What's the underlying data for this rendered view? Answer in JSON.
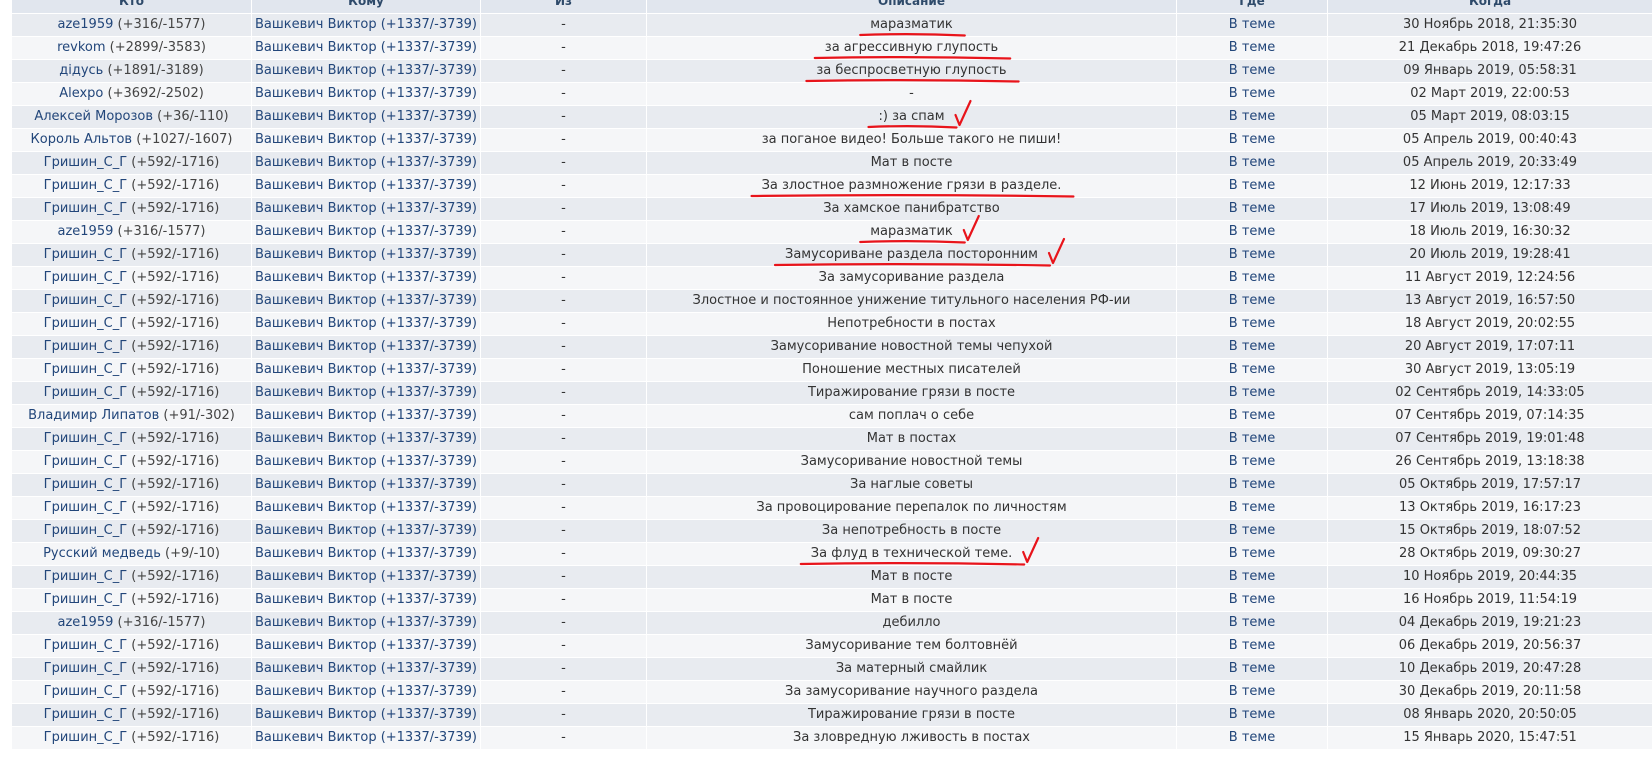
{
  "table": {
    "headers": [
      "Кто",
      "Кому",
      "Из",
      "Описание",
      "Где",
      "Когда"
    ],
    "rows": [
      {
        "who_name": "aze1959",
        "who_rep": "(+316/-1577)",
        "to": "Вашкевич Виктор (+1337/-3739)",
        "from": "-",
        "desc": "маразматик",
        "where": "В теме",
        "when": "30 Ноябрь 2018, 21:35:30"
      },
      {
        "who_name": "revkom",
        "who_rep": "(+2899/-3583)",
        "to": "Вашкевич Виктор (+1337/-3739)",
        "from": "-",
        "desc": "за агрессивную глупость",
        "where": "В теме",
        "when": "21 Декабрь 2018, 19:47:26"
      },
      {
        "who_name": "дідусь",
        "who_rep": "(+1891/-3189)",
        "to": "Вашкевич Виктор (+1337/-3739)",
        "from": "-",
        "desc": "за беспросветную глупость",
        "where": "В теме",
        "when": "09 Январь 2019, 05:58:31"
      },
      {
        "who_name": "Alexpo",
        "who_rep": "(+3692/-2502)",
        "to": "Вашкевич Виктор (+1337/-3739)",
        "from": "-",
        "desc": "-",
        "where": "В теме",
        "when": "02 Март 2019, 22:00:53"
      },
      {
        "who_name": "Алексей Морозов",
        "who_rep": "(+36/-110)",
        "to": "Вашкевич Виктор (+1337/-3739)",
        "from": "-",
        "desc": ":) за спам",
        "where": "В теме",
        "when": "05 Март 2019, 08:03:15"
      },
      {
        "who_name": "Король Альтов",
        "who_rep": "(+1027/-1607)",
        "to": "Вашкевич Виктор (+1337/-3739)",
        "from": "-",
        "desc": "за поганое видео! Больше такого не пиши!",
        "where": "В теме",
        "when": "05 Апрель 2019, 00:40:43"
      },
      {
        "who_name": "Гришин_С_Г",
        "who_rep": "(+592/-1716)",
        "to": "Вашкевич Виктор (+1337/-3739)",
        "from": "-",
        "desc": "Мат в посте",
        "where": "В теме",
        "when": "05 Апрель 2019, 20:33:49"
      },
      {
        "who_name": "Гришин_С_Г",
        "who_rep": "(+592/-1716)",
        "to": "Вашкевич Виктор (+1337/-3739)",
        "from": "-",
        "desc": "За злостное размножение грязи в разделе.",
        "where": "В теме",
        "when": "12 Июнь 2019, 12:17:33"
      },
      {
        "who_name": "Гришин_С_Г",
        "who_rep": "(+592/-1716)",
        "to": "Вашкевич Виктор (+1337/-3739)",
        "from": "-",
        "desc": "За хамское панибратство",
        "where": "В теме",
        "when": "17 Июль 2019, 13:08:49"
      },
      {
        "who_name": "aze1959",
        "who_rep": "(+316/-1577)",
        "to": "Вашкевич Виктор (+1337/-3739)",
        "from": "-",
        "desc": "маразматик",
        "where": "В теме",
        "when": "18 Июль 2019, 16:30:32"
      },
      {
        "who_name": "Гришин_С_Г",
        "who_rep": "(+592/-1716)",
        "to": "Вашкевич Виктор (+1337/-3739)",
        "from": "-",
        "desc": "Замусориване раздела посторонним",
        "where": "В теме",
        "when": "20 Июль 2019, 19:28:41"
      },
      {
        "who_name": "Гришин_С_Г",
        "who_rep": "(+592/-1716)",
        "to": "Вашкевич Виктор (+1337/-3739)",
        "from": "-",
        "desc": "За замусоривание раздела",
        "where": "В теме",
        "when": "11 Август 2019, 12:24:56"
      },
      {
        "who_name": "Гришин_С_Г",
        "who_rep": "(+592/-1716)",
        "to": "Вашкевич Виктор (+1337/-3739)",
        "from": "-",
        "desc": "Злостное и постоянное унижение титульного населения РФ-ии",
        "where": "В теме",
        "when": "13 Август 2019, 16:57:50"
      },
      {
        "who_name": "Гришин_С_Г",
        "who_rep": "(+592/-1716)",
        "to": "Вашкевич Виктор (+1337/-3739)",
        "from": "-",
        "desc": "Непотребности в постах",
        "where": "В теме",
        "when": "18 Август 2019, 20:02:55"
      },
      {
        "who_name": "Гришин_С_Г",
        "who_rep": "(+592/-1716)",
        "to": "Вашкевич Виктор (+1337/-3739)",
        "from": "-",
        "desc": "Замусоривание новостной темы чепухой",
        "where": "В теме",
        "when": "20 Август 2019, 17:07:11"
      },
      {
        "who_name": "Гришин_С_Г",
        "who_rep": "(+592/-1716)",
        "to": "Вашкевич Виктор (+1337/-3739)",
        "from": "-",
        "desc": "Поношение местных писателей",
        "where": "В теме",
        "when": "30 Август 2019, 13:05:19"
      },
      {
        "who_name": "Гришин_С_Г",
        "who_rep": "(+592/-1716)",
        "to": "Вашкевич Виктор (+1337/-3739)",
        "from": "-",
        "desc": "Тиражирование грязи в посте",
        "where": "В теме",
        "when": "02 Сентябрь 2019, 14:33:05"
      },
      {
        "who_name": "Владимир Липатов",
        "who_rep": "(+91/-302)",
        "to": "Вашкевич Виктор (+1337/-3739)",
        "from": "-",
        "desc": "сам поплач о себе",
        "where": "В теме",
        "when": "07 Сентябрь 2019, 07:14:35"
      },
      {
        "who_name": "Гришин_С_Г",
        "who_rep": "(+592/-1716)",
        "to": "Вашкевич Виктор (+1337/-3739)",
        "from": "-",
        "desc": "Мат в постах",
        "where": "В теме",
        "when": "07 Сентябрь 2019, 19:01:48"
      },
      {
        "who_name": "Гришин_С_Г",
        "who_rep": "(+592/-1716)",
        "to": "Вашкевич Виктор (+1337/-3739)",
        "from": "-",
        "desc": "Замусоривание новостной темы",
        "where": "В теме",
        "when": "26 Сентябрь 2019, 13:18:38"
      },
      {
        "who_name": "Гришин_С_Г",
        "who_rep": "(+592/-1716)",
        "to": "Вашкевич Виктор (+1337/-3739)",
        "from": "-",
        "desc": "За наглые советы",
        "where": "В теме",
        "when": "05 Октябрь 2019, 17:57:17"
      },
      {
        "who_name": "Гришин_С_Г",
        "who_rep": "(+592/-1716)",
        "to": "Вашкевич Виктор (+1337/-3739)",
        "from": "-",
        "desc": "За провоцирование перепалок по личностям",
        "where": "В теме",
        "when": "13 Октябрь 2019, 16:17:23"
      },
      {
        "who_name": "Гришин_С_Г",
        "who_rep": "(+592/-1716)",
        "to": "Вашкевич Виктор (+1337/-3739)",
        "from": "-",
        "desc": "За непотребность в посте",
        "where": "В теме",
        "when": "15 Октябрь 2019, 18:07:52"
      },
      {
        "who_name": "Русский медведь",
        "who_rep": "(+9/-10)",
        "to": "Вашкевич Виктор (+1337/-3739)",
        "from": "-",
        "desc": "За флуд в технической теме.",
        "where": "В теме",
        "when": "28 Октябрь 2019, 09:30:27"
      },
      {
        "who_name": "Гришин_С_Г",
        "who_rep": "(+592/-1716)",
        "to": "Вашкевич Виктор (+1337/-3739)",
        "from": "-",
        "desc": "Мат в посте",
        "where": "В теме",
        "when": "10 Ноябрь 2019, 20:44:35"
      },
      {
        "who_name": "Гришин_С_Г",
        "who_rep": "(+592/-1716)",
        "to": "Вашкевич Виктор (+1337/-3739)",
        "from": "-",
        "desc": "Мат в посте",
        "where": "В теме",
        "when": "16 Ноябрь 2019, 11:54:19"
      },
      {
        "who_name": "aze1959",
        "who_rep": "(+316/-1577)",
        "to": "Вашкевич Виктор (+1337/-3739)",
        "from": "-",
        "desc": "дебилло",
        "where": "В теме",
        "when": "04 Декабрь 2019, 19:21:23"
      },
      {
        "who_name": "Гришин_С_Г",
        "who_rep": "(+592/-1716)",
        "to": "Вашкевич Виктор (+1337/-3739)",
        "from": "-",
        "desc": "Замусоривание тем болтовнёй",
        "where": "В теме",
        "when": "06 Декабрь 2019, 20:56:37"
      },
      {
        "who_name": "Гришин_С_Г",
        "who_rep": "(+592/-1716)",
        "to": "Вашкевич Виктор (+1337/-3739)",
        "from": "-",
        "desc": "За матерный смайлик",
        "where": "В теме",
        "when": "10 Декабрь 2019, 20:47:28"
      },
      {
        "who_name": "Гришин_С_Г",
        "who_rep": "(+592/-1716)",
        "to": "Вашкевич Виктор (+1337/-3739)",
        "from": "-",
        "desc": "За замусоривание научного раздела",
        "where": "В теме",
        "when": "30 Декабрь 2019, 20:11:58"
      },
      {
        "who_name": "Гришин_С_Г",
        "who_rep": "(+592/-1716)",
        "to": "Вашкевич Виктор (+1337/-3739)",
        "from": "-",
        "desc": "Тиражирование грязи в посте",
        "where": "В теме",
        "when": "08 Январь 2020, 20:50:05"
      },
      {
        "who_name": "Гришин_С_Г",
        "who_rep": "(+592/-1716)",
        "to": "Вашкевич Виктор (+1337/-3739)",
        "from": "-",
        "desc": "За зловредную лживость в постах",
        "where": "В теме",
        "when": "15 Январь 2020, 15:47:51"
      }
    ]
  },
  "annotations": {
    "marker_color": "#e8141b",
    "underlined_rows": [
      0,
      1,
      2,
      4,
      7,
      9,
      10,
      23
    ],
    "checkmarked_rows": [
      4,
      9,
      10,
      23
    ]
  }
}
